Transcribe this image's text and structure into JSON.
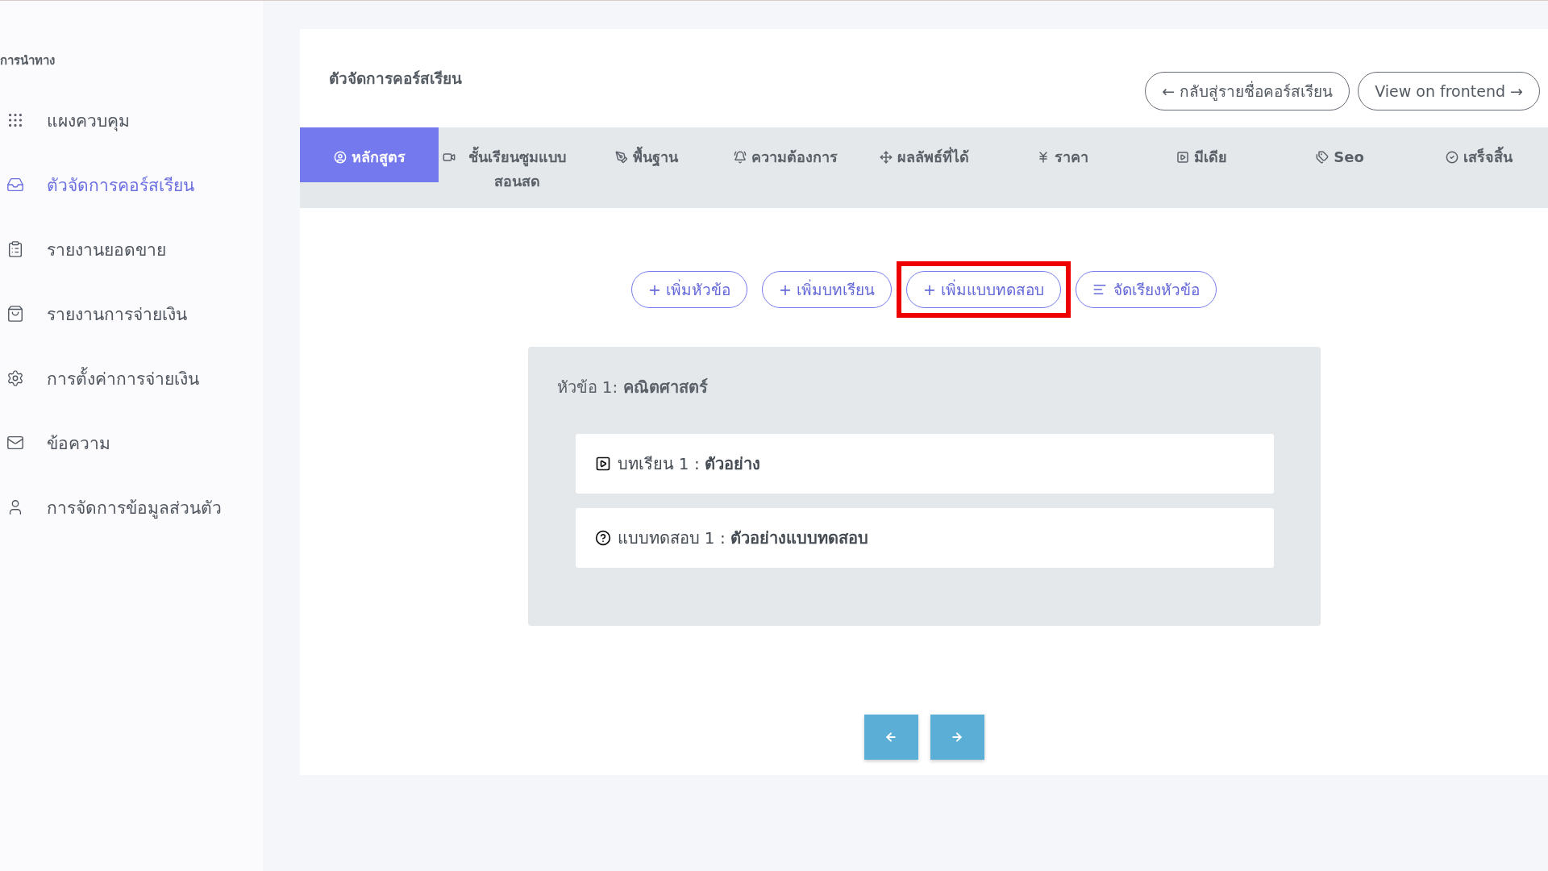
{
  "sidebar": {
    "heading": "การนำทาง",
    "items": [
      {
        "label": "แผงควบคุม",
        "selected": false
      },
      {
        "label": "ตัวจัดการคอร์สเรียน",
        "selected": true
      },
      {
        "label": "รายงานยอดขาย",
        "selected": false
      },
      {
        "label": "รายงานการจ่ายเงิน",
        "selected": false
      },
      {
        "label": "การตั้งค่าการจ่ายเงิน",
        "selected": false
      },
      {
        "label": "ข้อความ",
        "selected": false
      },
      {
        "label": "การจัดการข้อมูลส่วนตัว",
        "selected": false
      }
    ]
  },
  "header": {
    "title": "ตัวจัดการคอร์สเรียน",
    "buttons": [
      "← กลับสู่รายชื่อคอร์สเรียน",
      "View on frontend →"
    ]
  },
  "tabs": [
    {
      "label": "หลักสูตร",
      "selected": true
    },
    {
      "label": "ชั้นเรียนซูมแบบสอนสด",
      "selected": false
    },
    {
      "label": "พื้นฐาน",
      "selected": false
    },
    {
      "label": "ความต้องการ",
      "selected": false
    },
    {
      "label": "ผลลัพธ์ที่ได้",
      "selected": false
    },
    {
      "label": "ราคา",
      "selected": false
    },
    {
      "label": "มีเดีย",
      "selected": false
    },
    {
      "label": "Seo",
      "selected": false
    },
    {
      "label": "เสร็จสิ้น",
      "selected": false
    }
  ],
  "actions": [
    {
      "label": "+ เพิ่มหัวข้อ",
      "kind": "add",
      "highlighted": false
    },
    {
      "label": "+ เพิ่มบทเรียน",
      "kind": "add",
      "highlighted": false
    },
    {
      "label": "+ เพิ่มแบบทดสอบ",
      "kind": "add",
      "highlighted": true
    },
    {
      "label": "จัดเรียงหัวข้อ",
      "kind": "sort",
      "highlighted": false
    }
  ],
  "section": {
    "title": "หัวข้อ 1: **คณิตศาสตร์**",
    "items": [
      {
        "kind": "lesson",
        "label": "บทเรียน 1 : **ตัวอย่าง**"
      },
      {
        "kind": "quiz",
        "label": "แบบทดสอบ 1 : **ตัวอย่างแบบทดสอบ**"
      }
    ]
  }
}
